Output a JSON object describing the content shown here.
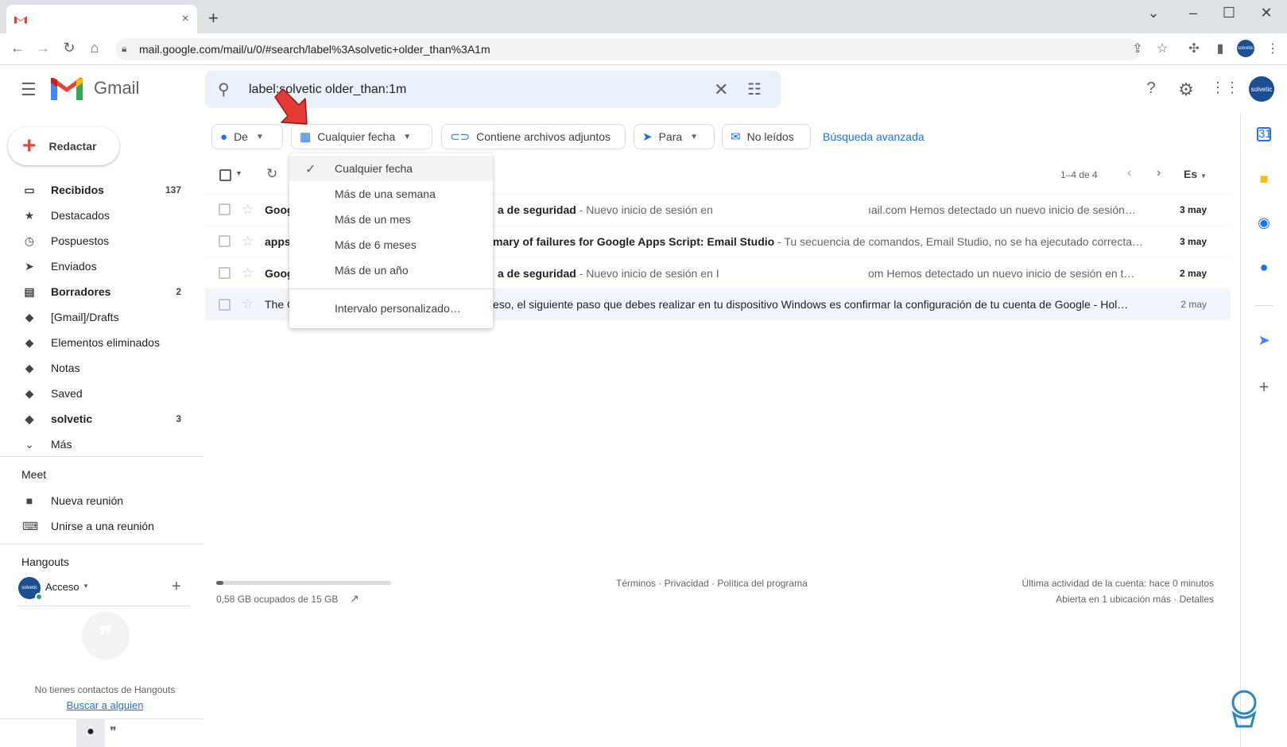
{
  "browser": {
    "tab_title": "",
    "url": "mail.google.com/mail/u/0/#search/label%3Asolvetic+older_than%3A1m",
    "profile_text": "solvetic"
  },
  "header": {
    "app_name": "Gmail",
    "search_query": "label:solvetic older_than:1m",
    "avatar_text": "solvetic"
  },
  "compose_label": "Redactar",
  "sidebar": {
    "items": [
      {
        "label": "Recibidos",
        "count": "137",
        "icon": "inbox-icon"
      },
      {
        "label": "Destacados",
        "count": "",
        "icon": "star-icon"
      },
      {
        "label": "Pospuestos",
        "count": "",
        "icon": "clock-icon"
      },
      {
        "label": "Enviados",
        "count": "",
        "icon": "send-icon"
      },
      {
        "label": "Borradores",
        "count": "2",
        "icon": "draft-icon"
      },
      {
        "label": "[Gmail]/Drafts",
        "count": "",
        "icon": "label-icon"
      },
      {
        "label": "Elementos eliminados",
        "count": "",
        "icon": "label-icon"
      },
      {
        "label": "Notas",
        "count": "",
        "icon": "label-icon"
      },
      {
        "label": "Saved",
        "count": "",
        "icon": "label-icon"
      },
      {
        "label": "solvetic",
        "count": "3",
        "icon": "label-icon"
      },
      {
        "label": "Más",
        "count": "",
        "icon": "chevron-down-icon"
      }
    ],
    "meet_title": "Meet",
    "meet_items": [
      "Nueva reunión",
      "Unirse a una reunión"
    ],
    "hangouts_title": "Hangouts",
    "hangouts_user": "Acceso",
    "hangouts_empty": "No tienes contactos de Hangouts",
    "hangouts_find": "Buscar a alguien"
  },
  "filters": {
    "from": "De",
    "date": "Cualquier fecha",
    "attachments": "Contiene archivos adjuntos",
    "to": "Para",
    "unread": "No leídos",
    "advanced": "Búsqueda avanzada"
  },
  "list": {
    "pager": "1–4 de 4",
    "lang": "Es"
  },
  "emails": [
    {
      "sender": "Goog",
      "subject": "a de seguridad",
      "snippet": " - Nuevo inicio de sesión en",
      "snippet2": "ıail.com Hemos detectado un nuevo inicio de sesión…",
      "date": "3 may",
      "read": false
    },
    {
      "sender": "apps",
      "subject": "mary of failures for Google Apps Script: Email Studio",
      "snippet": " - Tu secuencia de comandos, Email Studio, no se ha ejecutado correcta…",
      "snippet2": "",
      "date": "3 may",
      "read": false
    },
    {
      "sender": "Goog",
      "subject": "a de seguridad",
      "snippet": " - Nuevo inicio de sesión en I",
      "snippet2": "om Hemos detectado un nuevo inicio de sesión en t…",
      "date": "2 may",
      "read": false
    },
    {
      "sender": "The C",
      "subject": "",
      "snippet": "eso, el siguiente paso que debes realizar en tu dispositivo Windows es confirmar la configuración de tu cuenta de Google - Hol…",
      "snippet2": "",
      "date": "2 may",
      "read": true
    }
  ],
  "date_menu": {
    "items": [
      "Cualquier fecha",
      "Más de una semana",
      "Más de un mes",
      "Más de 6 meses",
      "Más de un año"
    ],
    "custom": "Intervalo personalizado…",
    "selected_index": 0
  },
  "footer": {
    "storage": "0,58 GB ocupados de 15 GB",
    "storage_fraction": 0.04,
    "terms": "Términos · Privacidad · Política del programa",
    "activity": "Última actividad de la cuenta: hace 0 minutos",
    "details": "Abierta en 1 ubicación más · Detalles"
  },
  "colors": {
    "accent": "#1a73e8",
    "arrow": "#e53935"
  }
}
